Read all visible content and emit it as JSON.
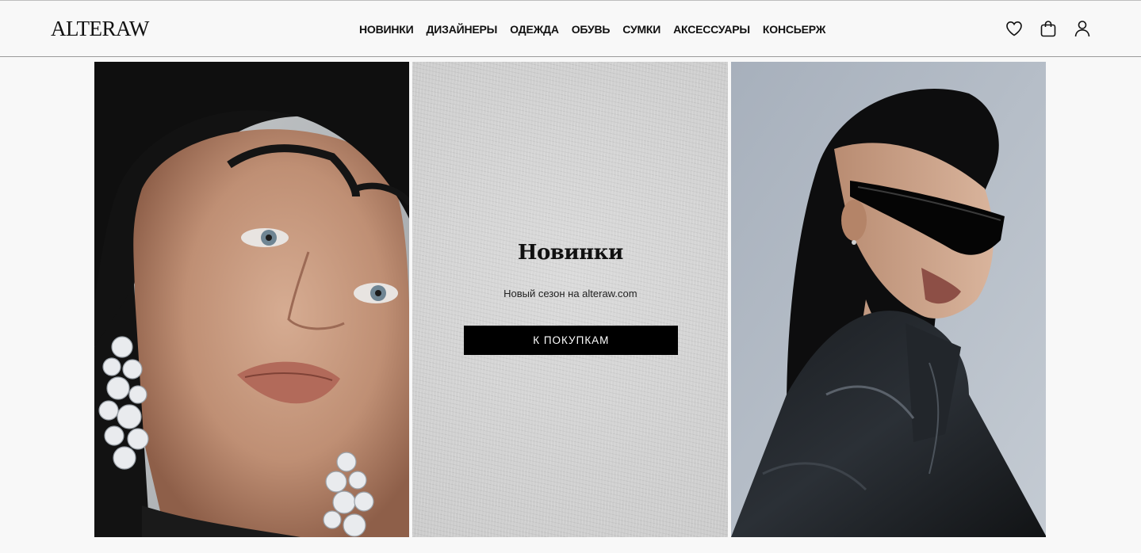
{
  "header": {
    "logo": "ALTERAW",
    "nav": [
      "НОВИНКИ",
      "ДИЗАЙНЕРЫ",
      "ОДЕЖДА",
      "ОБУВЬ",
      "СУМКИ",
      "АКСЕССУАРЫ",
      "КОНСЬЕРЖ"
    ],
    "icons": [
      "heart-icon",
      "shopping-bag-icon",
      "user-icon"
    ]
  },
  "promo": {
    "title": "Новинки",
    "subtitle": "Новый сезон на alteraw.com",
    "button": "К ПОКУПКАМ"
  },
  "colors": {
    "background": "#f8f8f8",
    "button_bg": "#000000",
    "button_text": "#ffffff",
    "text": "#111111"
  }
}
